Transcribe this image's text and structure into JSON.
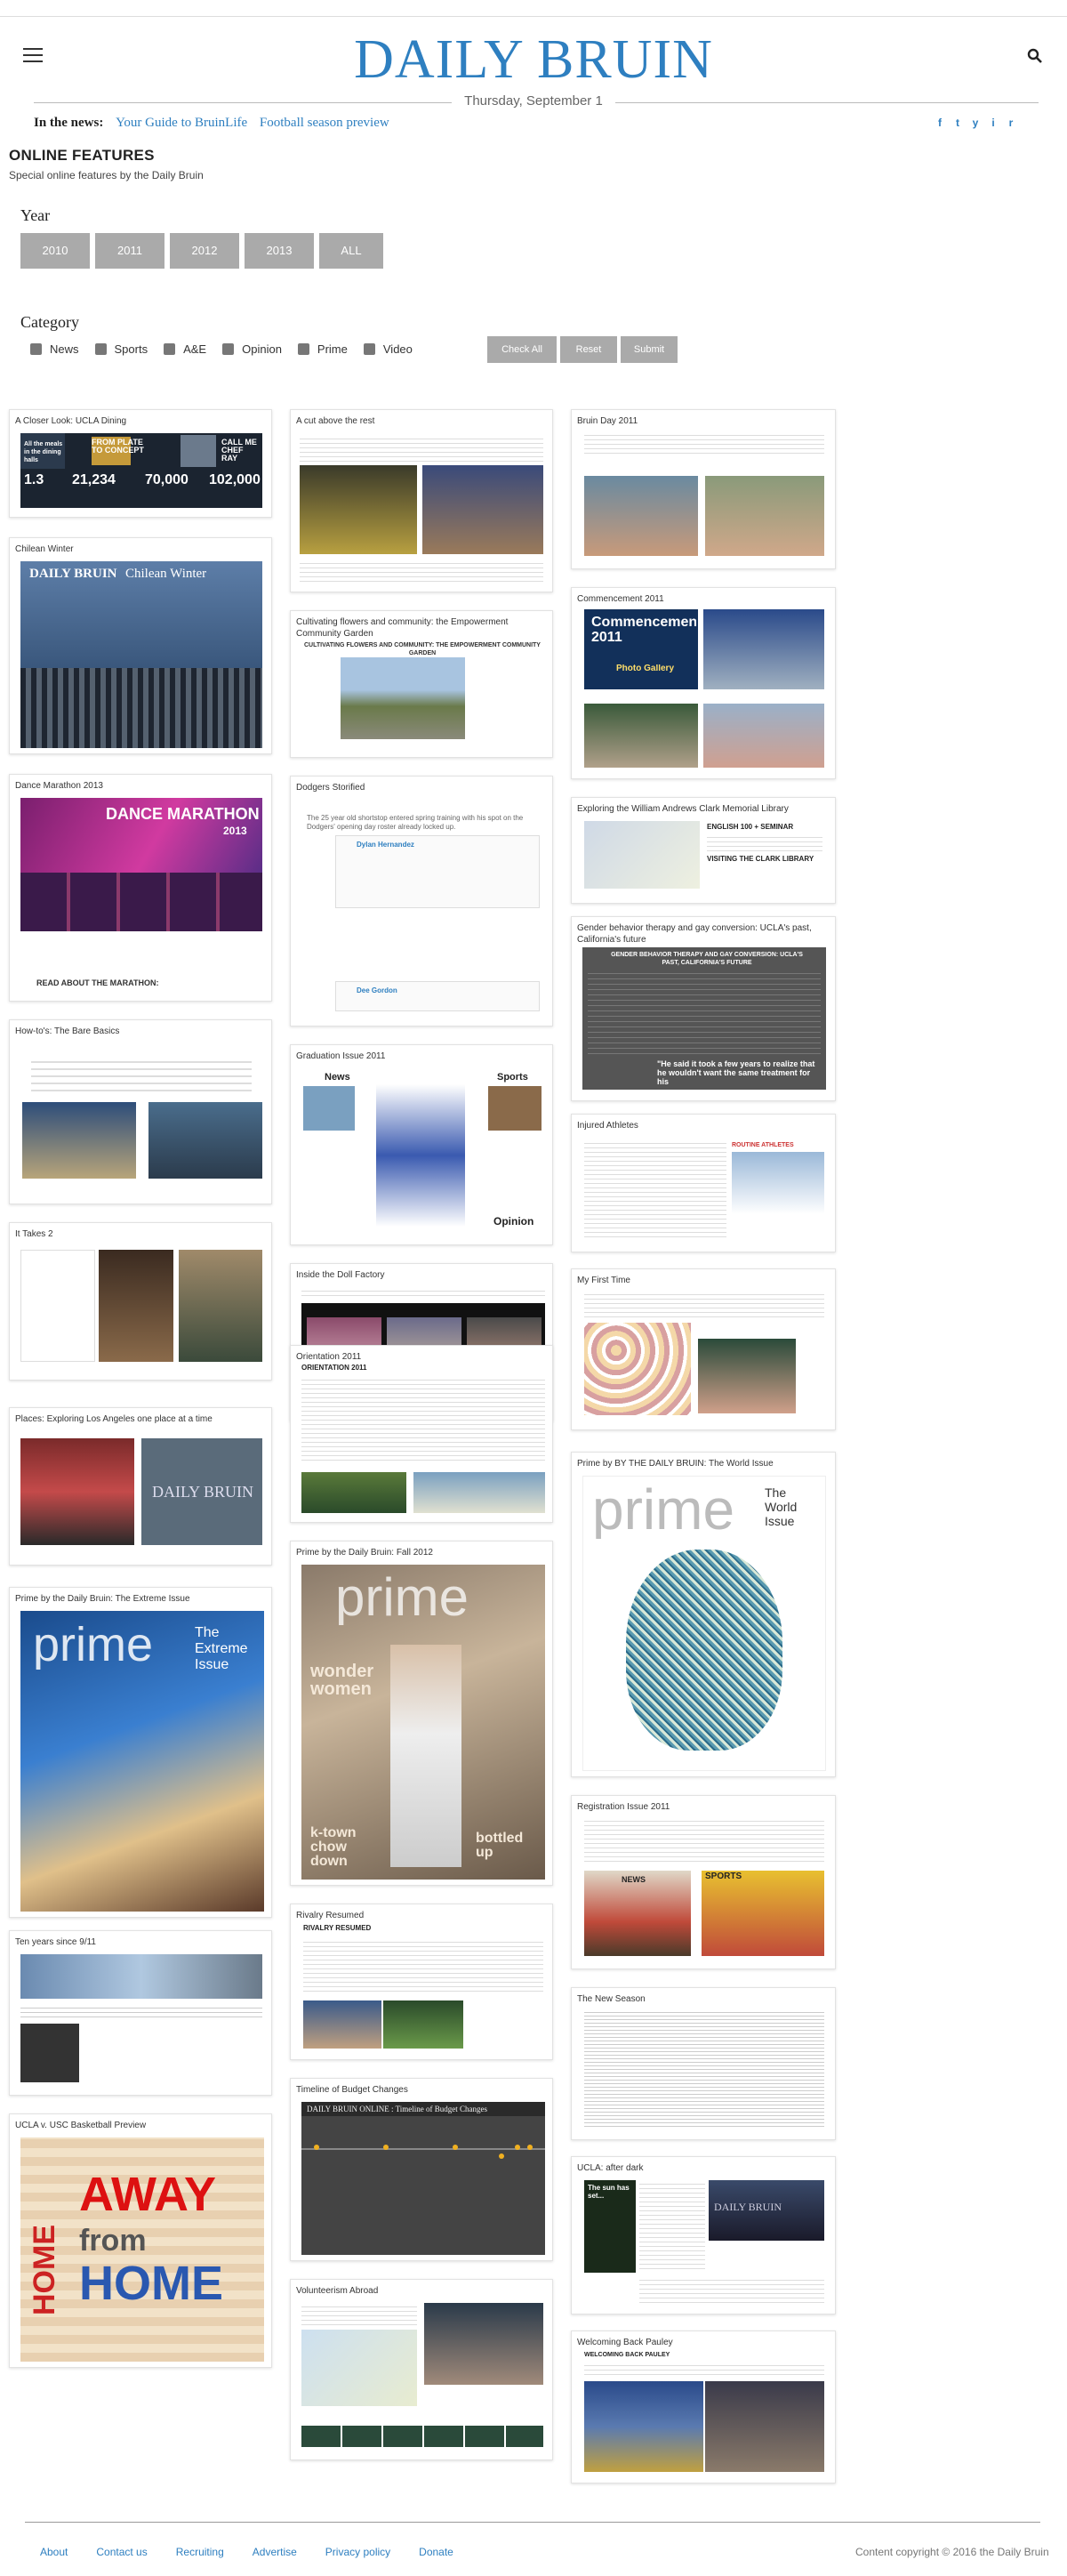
{
  "header": {
    "logo": "DAILY BRUIN",
    "date": "Thursday, September 1",
    "in_the_news_label": "In the news:",
    "news_links": [
      "Your Guide to BruinLife",
      "Football season preview"
    ],
    "social": [
      "f",
      "t",
      "y",
      "i",
      "r"
    ],
    "accent_color": "#2e7fc0"
  },
  "page": {
    "title": "ONLINE FEATURES",
    "subtitle": "Special online features by the Daily Bruin"
  },
  "filters": {
    "year_label": "Year",
    "years": [
      "2010",
      "2011",
      "2012",
      "2013",
      "ALL"
    ],
    "category_label": "Category",
    "categories": [
      "News",
      "Sports",
      "A&E",
      "Opinion",
      "Prime",
      "Video"
    ],
    "actions": [
      "Check All",
      "Reset",
      "Submit"
    ]
  },
  "cards": {
    "c1": {
      "title": "A Closer Look: UCLA Dining",
      "t1": "All the meals in the dining halls",
      "t2": "FROM PLATE TO CONCEPT",
      "t3": "CALL ME CHEF RAY",
      "n1": "1.3",
      "n2": "21,234",
      "n3": "70,000",
      "n4": "102,000"
    },
    "c2": {
      "title": "Chilean Winter",
      "logo": "DAILY BRUIN",
      "sub": "Chilean Winter"
    },
    "c3": {
      "title": "Dance Marathon 2013",
      "banner": "DANCE MARATHON",
      "year": "2013",
      "read": "READ ABOUT THE MARATHON:"
    },
    "c4": {
      "title": "How-to's: The Bare Basics"
    },
    "c5": {
      "title": "It Takes 2"
    },
    "c6": {
      "title": "Places: Exploring Los Angeles one place at a time",
      "logo": "DAILY BRUIN"
    },
    "c7": {
      "title": "Prime by the Daily Bruin: The Extreme Issue",
      "brand": "prime",
      "issue": "The Extreme Issue"
    },
    "c8": {
      "title": "Ten years since 9/11"
    },
    "c9": {
      "title": "UCLA v. USC Basketball Preview",
      "w1": "AWAY",
      "w2": "from",
      "w3": "HOME",
      "w4": "HOME"
    },
    "c10": {
      "title": "A cut above the rest"
    },
    "c11": {
      "title": "Cultivating flowers and community: the Empowerment Community Garden",
      "head": "CULTIVATING FLOWERS AND COMMUNITY: THE EMPOWERMENT COMMUNITY GARDEN"
    },
    "c12": {
      "title": "Dodgers Storified",
      "q1": "The 25 year old shortstop entered spring training with his spot on the Dodgers' opening day roster already locked up.",
      "q2": "Dylan Hernandez",
      "q3": "Dee Gordon"
    },
    "c13": {
      "title": "Graduation Issue 2011",
      "n": "News",
      "s": "Sports",
      "o": "Opinion"
    },
    "c14": {
      "title": "Inside the Doll Factory"
    },
    "c15": {
      "title": "Orientation 2011",
      "head": "ORIENTATION 2011"
    },
    "c16": {
      "title": "Prime by the Daily Bruin: Fall 2012",
      "brand": "prime",
      "w": "wonder women",
      "k": "k-town chow down",
      "b": "bottled up"
    },
    "c17": {
      "title": "Rivalry Resumed",
      "head": "RIVALRY RESUMED"
    },
    "c18": {
      "title": "Timeline of Budget Changes",
      "head": "DAILY BRUIN ONLINE : Timeline of Budget Changes"
    },
    "c19": {
      "title": "Volunteerism Abroad"
    },
    "c20": {
      "title": "Bruin Day 2011"
    },
    "c21": {
      "title": "Commencement 2011",
      "head": "Commencement 2011",
      "sub": "Photo Gallery"
    },
    "c22": {
      "title": "Exploring the William Andrews Clark Memorial Library",
      "h1": "ENGLISH 100 + SEMINAR",
      "h2": "VISITING THE CLARK LIBRARY"
    },
    "c23": {
      "title": "Gender behavior therapy and gay conversion: UCLA's past, California's future",
      "head": "GENDER BEHAVIOR THERAPY AND GAY CONVERSION: UCLA'S PAST, CALIFORNIA'S FUTURE",
      "quote": "\"He said it took a few years to realize that he wouldn't want the same treatment for his"
    },
    "c24": {
      "title": "Injured Athletes",
      "tag": "ROUTINE ATHLETES"
    },
    "c25": {
      "title": "My First Time"
    },
    "c26": {
      "title": "Prime by BY THE DAILY BRUIN: The World Issue",
      "brand": "prime",
      "issue": "The World Issue"
    },
    "c27": {
      "title": "Registration Issue 2011",
      "n": "NEWS",
      "s": "SPORTS"
    },
    "c28": {
      "title": "The New Season"
    },
    "c29": {
      "title": "UCLA: after dark",
      "head": "The sun has set...",
      "logo": "DAILY BRUIN"
    },
    "c30": {
      "title": "Welcoming Back Pauley",
      "head": "WELCOMING BACK PAULEY"
    }
  },
  "footer": {
    "links": [
      "About",
      "Contact us",
      "Recruiting",
      "Advertise",
      "Privacy policy",
      "Donate"
    ],
    "copyright": "Content copyright © 2016 the Daily Bruin"
  }
}
